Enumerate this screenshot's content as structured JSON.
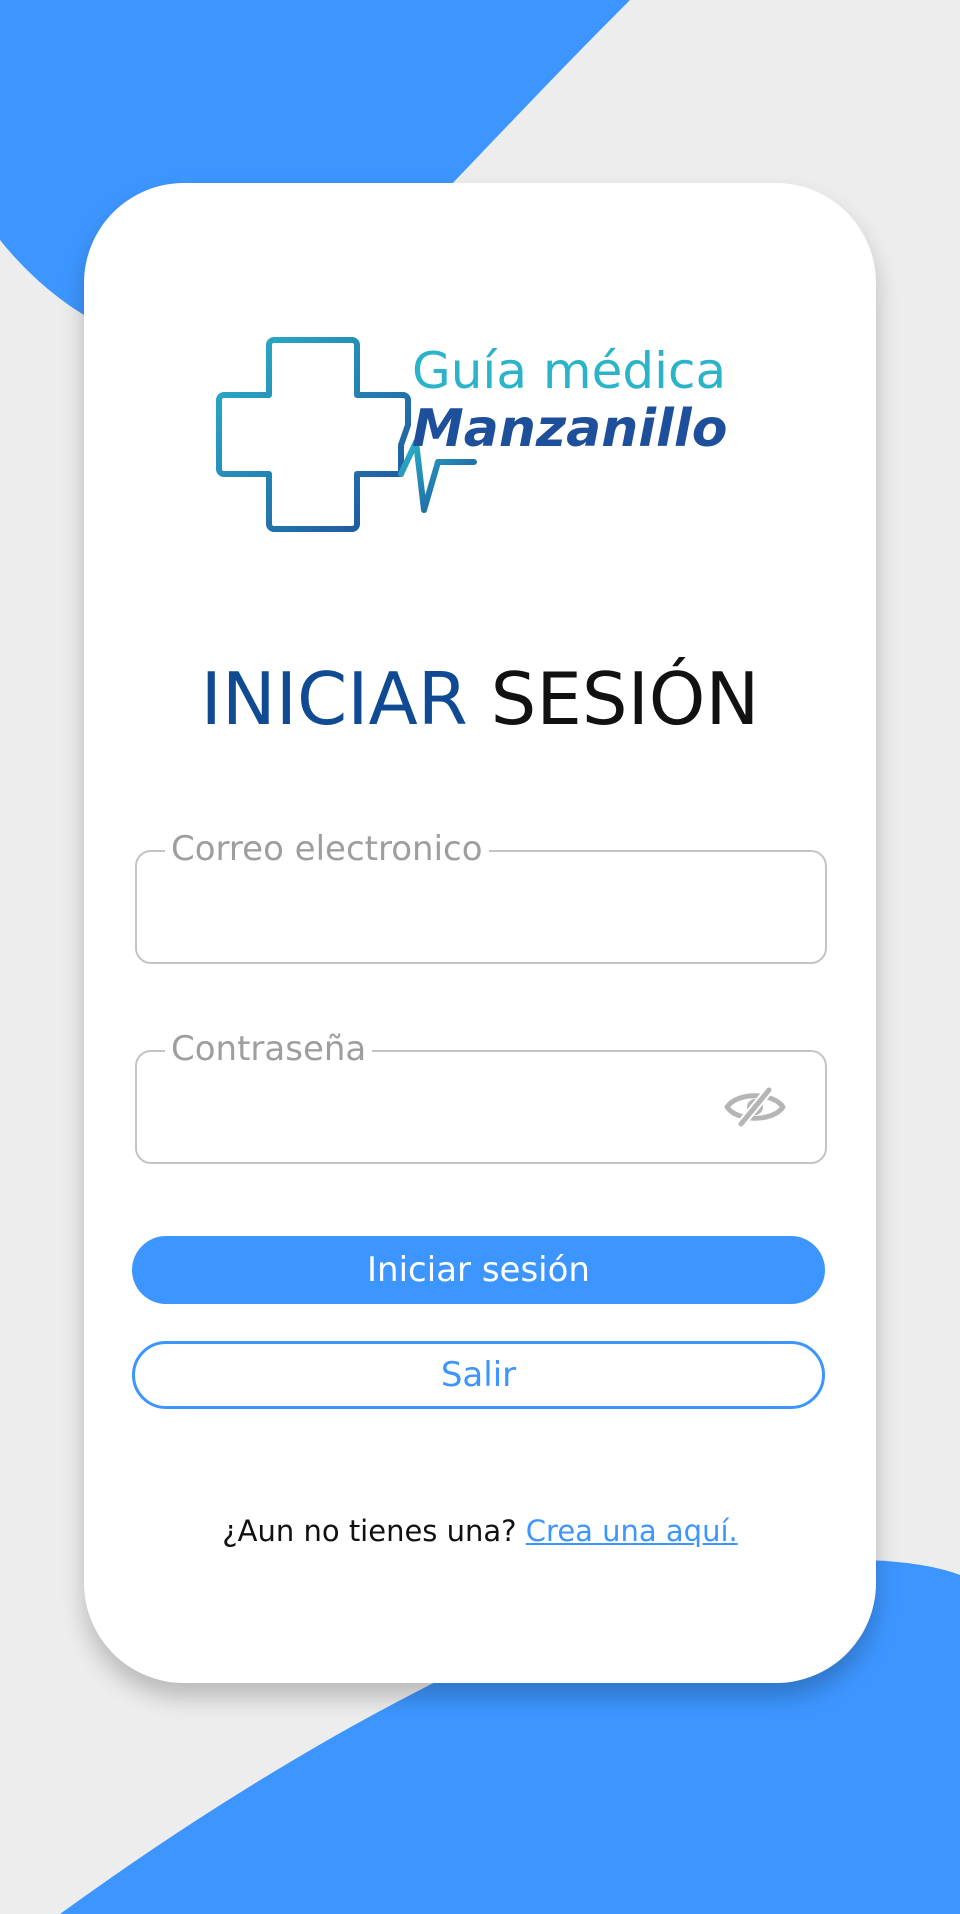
{
  "app": {
    "logo_line1": "Guía médica",
    "logo_line2": "Manzanillo"
  },
  "login": {
    "title_word1": "INICIAR",
    "title_word2": "SESIÓN",
    "email": {
      "label": "Correo electronico",
      "value": ""
    },
    "password": {
      "label": "Contraseña",
      "value": "",
      "toggle_icon": "eye-off-icon"
    },
    "submit_label": "Iniciar sesión",
    "exit_label": "Salir",
    "signup_prompt": "¿Aun no tienes una?",
    "signup_link": "Crea una aquí."
  },
  "colors": {
    "accent": "#3d96ff",
    "title_blue": "#0f4a93",
    "logo_teal": "#2bb3c9",
    "logo_navy": "#1d4f9a",
    "background": "#ededed"
  }
}
